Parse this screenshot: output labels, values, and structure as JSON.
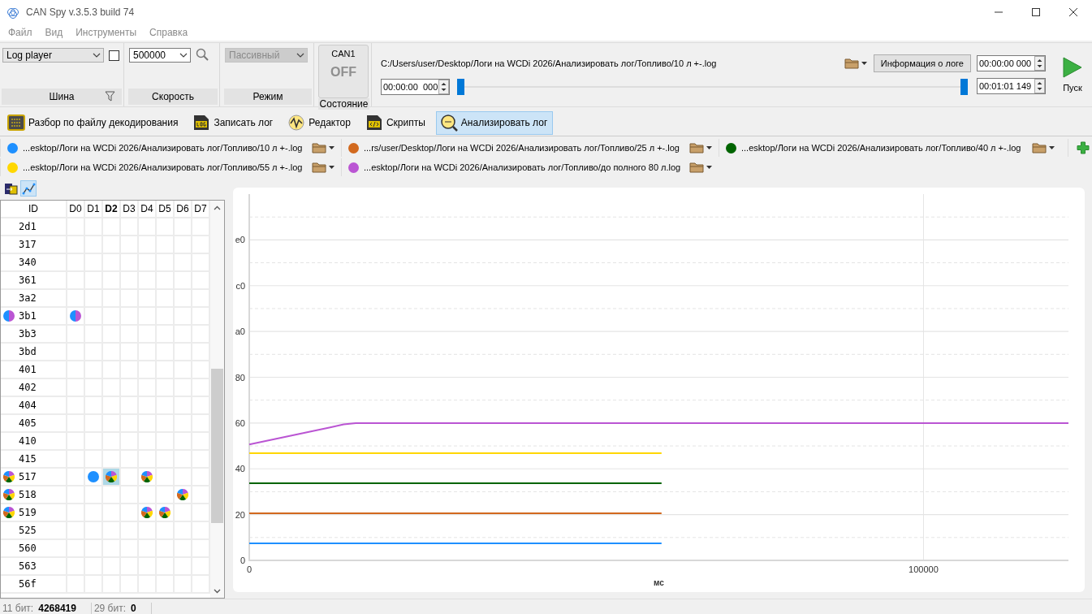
{
  "window": {
    "title": "CAN Spy v.3.5.3 build 74"
  },
  "menu": [
    "Файл",
    "Вид",
    "Инструменты",
    "Справка"
  ],
  "toolbar": {
    "bus": {
      "label": "Шина",
      "value": "Log player",
      "checked": false
    },
    "speed": {
      "label": "Скорость",
      "value": "500000"
    },
    "mode": {
      "label": "Режим",
      "value": "Пассивный",
      "disabled": true
    },
    "state": {
      "label": "Состояние",
      "channel": "CAN1",
      "value": "OFF",
      "on": false
    },
    "player": {
      "path": "C:/Users/user/Desktop/Логи на WCDi 2026/Анализировать лог/Топливо/10 л +-.log",
      "info_button": "Информация о логе",
      "position": "00:00:00  000",
      "range_start": "00:00:00 000",
      "range_end": "00:01:01 149",
      "start_handle": {
        "level": 0
      },
      "end_handle": {
        "level": 1
      },
      "play_label": "Пуск"
    }
  },
  "tools": [
    {
      "kind": "decode",
      "label": "Разбор по файлу декодирования",
      "selected": false
    },
    {
      "kind": "record",
      "label": "Записать лог",
      "selected": false
    },
    {
      "kind": "editor",
      "label": "Редактор",
      "selected": false
    },
    {
      "kind": "scripts",
      "label": "Скрипты",
      "selected": false
    },
    {
      "kind": "analyze",
      "label": "Анализировать лог",
      "selected": true
    }
  ],
  "logs": [
    {
      "path": "...esktop/Логи на WCDi 2026/Анализировать лог/Топливо/10 л +-.log",
      "color": "#1e90ff"
    },
    {
      "path": "...rs/user/Desktop/Логи на WCDi 2026/Анализировать лог/Топливо/25 л +-.log",
      "color": "#d2691e"
    },
    {
      "path": "...esktop/Логи на WCDi 2026/Анализировать лог/Топливо/40 л +-.log",
      "color": "#006400"
    },
    {
      "path": "...esktop/Логи на WCDi 2026/Анализировать лог/Топливо/55 л +-.log",
      "color": "#ffd700"
    },
    {
      "path": "...esktop/Логи на WCDi 2026/Анализировать лог/Топливо/до полного 80 л.log",
      "color": "#ba55d3"
    }
  ],
  "view_buttons": [
    {
      "kind": "export",
      "selected": false
    },
    {
      "kind": "chart",
      "selected": true
    }
  ],
  "table": {
    "columns": [
      {
        "label": "ID",
        "selected": false
      },
      {
        "label": "D0",
        "selected": false
      },
      {
        "label": "D1",
        "selected": false
      },
      {
        "label": "D2",
        "selected": true
      },
      {
        "label": "D3",
        "selected": false
      },
      {
        "label": "D4",
        "selected": false
      },
      {
        "label": "D5",
        "selected": false
      },
      {
        "label": "D6",
        "selected": false
      },
      {
        "label": "D7",
        "selected": false
      }
    ],
    "rows": [
      {
        "id": "2d1"
      },
      {
        "id": "317"
      },
      {
        "id": "340"
      },
      {
        "id": "361"
      },
      {
        "id": "3a2"
      },
      {
        "id": "3b1",
        "kind": "split",
        "d0": {
          "kind": "split",
          "selected": false
        }
      },
      {
        "id": "3b3"
      },
      {
        "id": "3bd"
      },
      {
        "id": "401"
      },
      {
        "id": "402"
      },
      {
        "id": "404"
      },
      {
        "id": "405"
      },
      {
        "id": "410"
      },
      {
        "id": "415"
      },
      {
        "id": "517",
        "kind": "pie",
        "d1": {
          "kind": "dot",
          "selected": false
        },
        "d2": {
          "kind": "pie",
          "selected": true
        },
        "d4": {
          "kind": "pie",
          "selected": false
        }
      },
      {
        "id": "518",
        "kind": "pie",
        "d6": {
          "kind": "pie",
          "selected": false
        }
      },
      {
        "id": "519",
        "kind": "pie",
        "d4": {
          "kind": "pie",
          "selected": false
        },
        "d5": {
          "kind": "pie",
          "selected": false
        }
      },
      {
        "id": "525"
      },
      {
        "id": "560"
      },
      {
        "id": "563"
      },
      {
        "id": "56f"
      }
    ]
  },
  "chart": {
    "y_labels": [
      "e0",
      "c0",
      "a0",
      "80",
      "60",
      "40",
      "20",
      "0"
    ],
    "x_labels": [
      "0",
      "100000"
    ],
    "x_title": "мс"
  },
  "status_bar": [
    {
      "label": "11 бит:",
      "value": "4268419"
    },
    {
      "label": "29 бит:",
      "value": "0"
    }
  ]
}
